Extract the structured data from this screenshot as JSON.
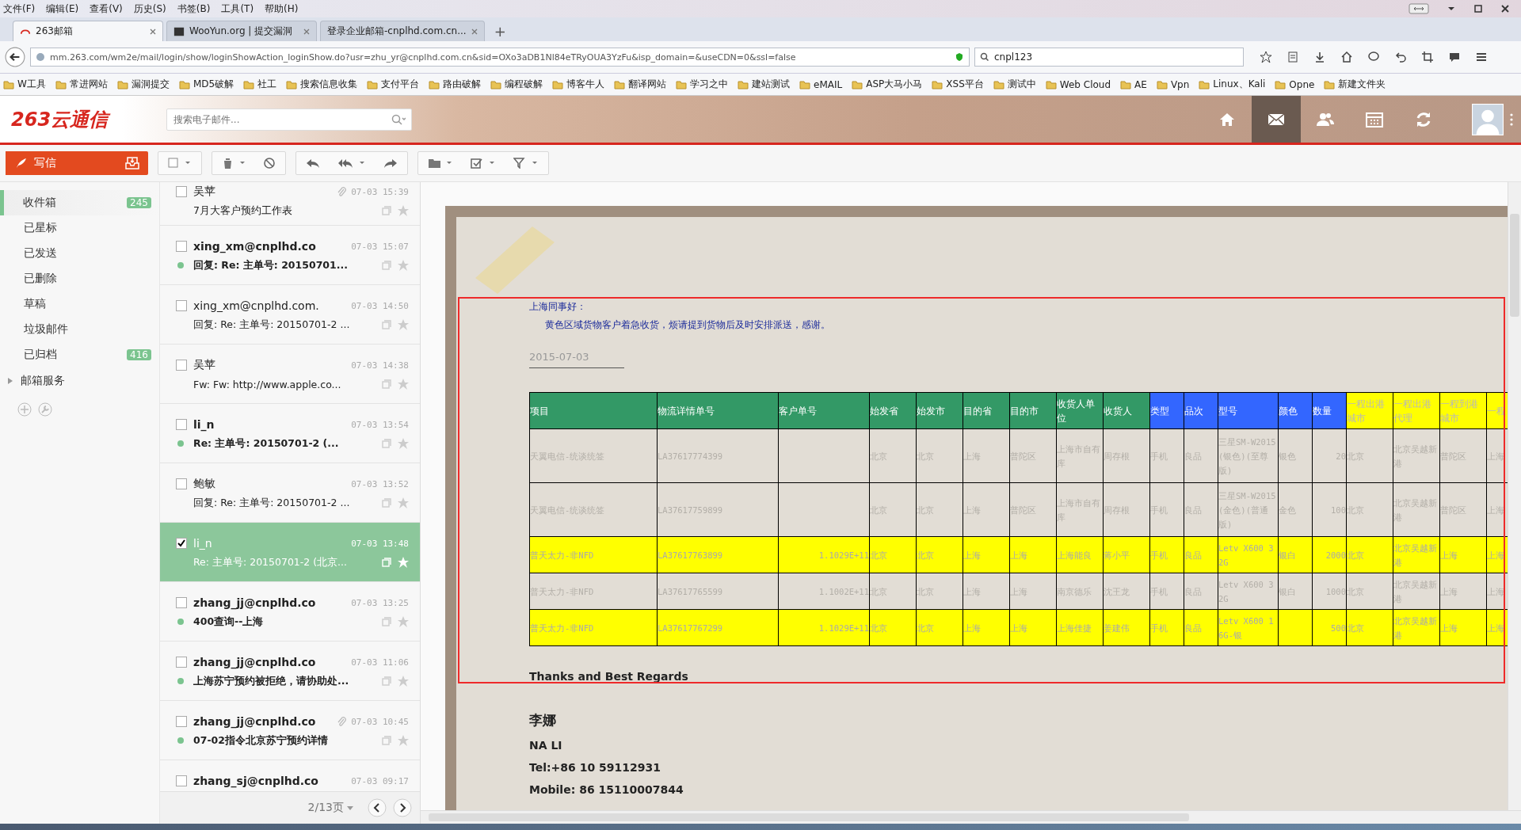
{
  "browser": {
    "menu": [
      "文件(F)",
      "编辑(E)",
      "查看(V)",
      "历史(S)",
      "书签(B)",
      "工具(T)",
      "帮助(H)"
    ],
    "tabs": [
      {
        "title": "263邮箱",
        "selected": true
      },
      {
        "title": "WooYun.org | 提交漏洞",
        "selected": false
      },
      {
        "title": "登录企业邮箱-cnplhd.com.cn...",
        "selected": false
      }
    ],
    "new_tab": "+",
    "url": "mm.263.com/wm2e/mail/login/show/loginShowAction_loginShow.do?usr=zhu_yr@cnplhd.com.cn&sid=OXo3aDB1Nl84eTRyOUA3YzFu&isp_domain=&useCDN=0&ssl=false",
    "search": "cnpl123",
    "bookmarks": [
      "W工具",
      "常进网站",
      "漏洞提交",
      "MD5破解",
      "社工",
      "搜索信息收集",
      "支付平台",
      "路由破解",
      "编程破解",
      "博客牛人",
      "翻译网站",
      "学习之中",
      "建站测试",
      "eMAIL",
      "ASP大马小马",
      "XSS平台",
      "测试中",
      "Web Cloud",
      "AE",
      "Vpn",
      "Linux、Kali",
      "Opne",
      "新建文件夹"
    ]
  },
  "header": {
    "logo": "263云通信",
    "search_placeholder": "搜索电子邮件...",
    "nav": [
      {
        "kind": "home",
        "selected": false
      },
      {
        "kind": "mail",
        "selected": true
      },
      {
        "kind": "contacts",
        "selected": false
      },
      {
        "kind": "calendar",
        "selected": false
      },
      {
        "kind": "sync",
        "selected": false
      }
    ]
  },
  "compose": "写信",
  "select_all": {
    "checked": false
  },
  "folders": [
    {
      "label": "收件箱",
      "count": "245",
      "selected": true
    },
    {
      "label": "已星标",
      "selected": false
    },
    {
      "label": "已发送",
      "selected": false
    },
    {
      "label": "已删除",
      "selected": false
    },
    {
      "label": "草稿",
      "selected": false
    },
    {
      "label": "垃圾邮件",
      "selected": false
    },
    {
      "label": "已归档",
      "count": "416",
      "selected": false
    }
  ],
  "services": {
    "label": "邮箱服务",
    "expanded": false
  },
  "mail": {
    "items": [
      {
        "sender": "吴苹",
        "time": "07-03 15:39",
        "subject": "7月大客户预约工作表",
        "unread": false,
        "checked": false,
        "selected": false,
        "attachment": true
      },
      {
        "sender": "xing_xm@cnplhd.co",
        "time": "07-03 15:07",
        "subject": "回复: Re: 主单号: 20150701...",
        "unread": true,
        "checked": false,
        "selected": false,
        "attachment": false
      },
      {
        "sender": "xing_xm@cnplhd.com.",
        "time": "07-03 14:50",
        "subject": "回复: Re: 主单号: 20150701-2 ...",
        "unread": false,
        "checked": false,
        "selected": false,
        "attachment": false
      },
      {
        "sender": "吴苹",
        "time": "07-03 14:38",
        "subject": "Fw: Fw: http://www.apple.co...",
        "unread": false,
        "checked": false,
        "selected": false,
        "attachment": false
      },
      {
        "sender": "li_n",
        "time": "07-03 13:54",
        "subject": "Re: 主单号: 20150701-2 (...",
        "unread": true,
        "checked": false,
        "selected": false,
        "attachment": false
      },
      {
        "sender": "鲍敏",
        "time": "07-03 13:52",
        "subject": "回复: Re: 主单号: 20150701-2 ...",
        "unread": false,
        "checked": false,
        "selected": false,
        "attachment": false
      },
      {
        "sender": "li_n",
        "time": "07-03 13:48",
        "subject": "Re: 主单号: 20150701-2 (北京...",
        "unread": false,
        "checked": true,
        "selected": true,
        "attachment": false
      },
      {
        "sender": "zhang_jj@cnplhd.co",
        "time": "07-03 13:25",
        "subject": "400查询--上海",
        "unread": true,
        "checked": false,
        "selected": false,
        "attachment": false
      },
      {
        "sender": "zhang_jj@cnplhd.co",
        "time": "07-03 11:06",
        "subject": "上海苏宁预约被拒绝，请协助处...",
        "unread": true,
        "checked": false,
        "selected": false,
        "attachment": false
      },
      {
        "sender": "zhang_jj@cnplhd.co",
        "time": "07-03 10:45",
        "subject": "07-02指令北京苏宁预约详情",
        "unread": true,
        "checked": false,
        "selected": false,
        "attachment": true
      },
      {
        "sender": "zhang_sj@cnplhd.co",
        "time": "07-03 09:17",
        "unread": true,
        "checked": false,
        "selected": false,
        "attachment": false
      }
    ],
    "pager": "2/13页"
  },
  "message": {
    "greeting": "上海同事好：",
    "body": "黄色区域货物客户着急收货，烦请提到货物后及时安排派送，感谢。",
    "date": "2015-07-03",
    "table": {
      "columns": [
        {
          "label": "项目",
          "color": "#339966"
        },
        {
          "label": "物流详情单号",
          "color": "#339966"
        },
        {
          "label": "客户单号",
          "color": "#339966"
        },
        {
          "label": "始发省",
          "color": "#339966"
        },
        {
          "label": "始发市",
          "color": "#339966"
        },
        {
          "label": "目的省",
          "color": "#339966"
        },
        {
          "label": "目的市",
          "color": "#339966"
        },
        {
          "label": "收货人单位",
          "color": "#339966"
        },
        {
          "label": "收货人",
          "color": "#339966"
        },
        {
          "label": "类型",
          "color": "#3366ff"
        },
        {
          "label": "品次",
          "color": "#3366ff"
        },
        {
          "label": "型号",
          "color": "#3366ff"
        },
        {
          "label": "颜色",
          "color": "#3366ff"
        },
        {
          "label": "数量",
          "color": "#3366ff"
        },
        {
          "label": "一程出港城市",
          "color": "#ffff00"
        },
        {
          "label": "一程出港代理",
          "color": "#ffff00"
        },
        {
          "label": "一程到港城市",
          "color": "#ffff00"
        },
        {
          "label": "一程",
          "color": "#ffff00"
        }
      ],
      "rows": [
        {
          "highlighted": false,
          "cells": [
            "天翼电信-统谈统签",
            "LA37617774399",
            "",
            "北京",
            "北京",
            "上海",
            "普陀区",
            "上海市自有库",
            "周存根",
            "手机",
            "良品",
            "三星SM-W2015(银色)(至尊版)",
            "银色",
            "20",
            "北京",
            "北京吴越新港",
            "普陀区",
            "上海"
          ]
        },
        {
          "highlighted": false,
          "cells": [
            "天翼电信-统谈统签",
            "LA37617759899",
            "",
            "北京",
            "北京",
            "上海",
            "普陀区",
            "上海市自有库",
            "周存根",
            "手机",
            "良品",
            "三星SM-W2015(金色)(普通版)",
            "金色",
            "100",
            "北京",
            "北京吴越新港",
            "普陀区",
            "上海"
          ]
        },
        {
          "highlighted": true,
          "cells": [
            "普天太力-非NFD",
            "LA37617763899",
            "1.1029E+11",
            "北京",
            "北京",
            "上海",
            "上海",
            "上海能良",
            "蒋小平",
            "手机",
            "良品",
            "Letv X600 32G",
            "银白",
            "2000",
            "北京",
            "北京吴越新港",
            "上海",
            "上海"
          ]
        },
        {
          "highlighted": false,
          "cells": [
            "普天太力-非NFD",
            "LA37617765599",
            "1.1002E+11",
            "北京",
            "北京",
            "上海",
            "上海",
            "南京德乐",
            "沈王龙",
            "手机",
            "良品",
            "Letv X600 32G",
            "银白",
            "1000",
            "北京",
            "北京吴越新港",
            "上海",
            "上海"
          ]
        },
        {
          "highlighted": true,
          "cells": [
            "普天太力-非NFD",
            "LA37617767299",
            "1.1029E+11",
            "北京",
            "北京",
            "上海",
            "上海",
            "上海佳捷",
            "姜建伟",
            "手机",
            "良品",
            "Letv X600 16G-银",
            "",
            "500",
            "北京",
            "北京吴越新港",
            "上海",
            "上海"
          ]
        }
      ]
    },
    "closing": "Thanks and Best Regards",
    "signature": [
      "李娜",
      "NA  LI",
      "Tel:+86 10 59112931",
      "Mobile: 86 15110007844"
    ]
  }
}
